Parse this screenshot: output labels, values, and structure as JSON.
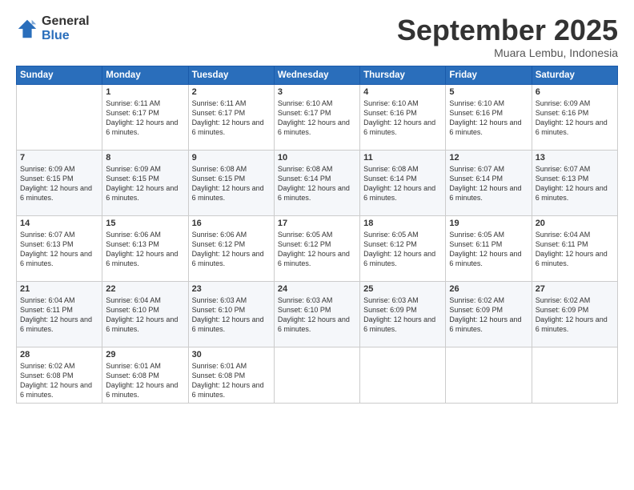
{
  "header": {
    "logo_general": "General",
    "logo_blue": "Blue",
    "month": "September 2025",
    "location": "Muara Lembu, Indonesia"
  },
  "weekdays": [
    "Sunday",
    "Monday",
    "Tuesday",
    "Wednesday",
    "Thursday",
    "Friday",
    "Saturday"
  ],
  "weeks": [
    [
      {
        "day": "",
        "sunrise": "",
        "sunset": "",
        "daylight": ""
      },
      {
        "day": "1",
        "sunrise": "Sunrise: 6:11 AM",
        "sunset": "Sunset: 6:17 PM",
        "daylight": "Daylight: 12 hours and 6 minutes."
      },
      {
        "day": "2",
        "sunrise": "Sunrise: 6:11 AM",
        "sunset": "Sunset: 6:17 PM",
        "daylight": "Daylight: 12 hours and 6 minutes."
      },
      {
        "day": "3",
        "sunrise": "Sunrise: 6:10 AM",
        "sunset": "Sunset: 6:17 PM",
        "daylight": "Daylight: 12 hours and 6 minutes."
      },
      {
        "day": "4",
        "sunrise": "Sunrise: 6:10 AM",
        "sunset": "Sunset: 6:16 PM",
        "daylight": "Daylight: 12 hours and 6 minutes."
      },
      {
        "day": "5",
        "sunrise": "Sunrise: 6:10 AM",
        "sunset": "Sunset: 6:16 PM",
        "daylight": "Daylight: 12 hours and 6 minutes."
      },
      {
        "day": "6",
        "sunrise": "Sunrise: 6:09 AM",
        "sunset": "Sunset: 6:16 PM",
        "daylight": "Daylight: 12 hours and 6 minutes."
      }
    ],
    [
      {
        "day": "7",
        "sunrise": "Sunrise: 6:09 AM",
        "sunset": "Sunset: 6:15 PM",
        "daylight": "Daylight: 12 hours and 6 minutes."
      },
      {
        "day": "8",
        "sunrise": "Sunrise: 6:09 AM",
        "sunset": "Sunset: 6:15 PM",
        "daylight": "Daylight: 12 hours and 6 minutes."
      },
      {
        "day": "9",
        "sunrise": "Sunrise: 6:08 AM",
        "sunset": "Sunset: 6:15 PM",
        "daylight": "Daylight: 12 hours and 6 minutes."
      },
      {
        "day": "10",
        "sunrise": "Sunrise: 6:08 AM",
        "sunset": "Sunset: 6:14 PM",
        "daylight": "Daylight: 12 hours and 6 minutes."
      },
      {
        "day": "11",
        "sunrise": "Sunrise: 6:08 AM",
        "sunset": "Sunset: 6:14 PM",
        "daylight": "Daylight: 12 hours and 6 minutes."
      },
      {
        "day": "12",
        "sunrise": "Sunrise: 6:07 AM",
        "sunset": "Sunset: 6:14 PM",
        "daylight": "Daylight: 12 hours and 6 minutes."
      },
      {
        "day": "13",
        "sunrise": "Sunrise: 6:07 AM",
        "sunset": "Sunset: 6:13 PM",
        "daylight": "Daylight: 12 hours and 6 minutes."
      }
    ],
    [
      {
        "day": "14",
        "sunrise": "Sunrise: 6:07 AM",
        "sunset": "Sunset: 6:13 PM",
        "daylight": "Daylight: 12 hours and 6 minutes."
      },
      {
        "day": "15",
        "sunrise": "Sunrise: 6:06 AM",
        "sunset": "Sunset: 6:13 PM",
        "daylight": "Daylight: 12 hours and 6 minutes."
      },
      {
        "day": "16",
        "sunrise": "Sunrise: 6:06 AM",
        "sunset": "Sunset: 6:12 PM",
        "daylight": "Daylight: 12 hours and 6 minutes."
      },
      {
        "day": "17",
        "sunrise": "Sunrise: 6:05 AM",
        "sunset": "Sunset: 6:12 PM",
        "daylight": "Daylight: 12 hours and 6 minutes."
      },
      {
        "day": "18",
        "sunrise": "Sunrise: 6:05 AM",
        "sunset": "Sunset: 6:12 PM",
        "daylight": "Daylight: 12 hours and 6 minutes."
      },
      {
        "day": "19",
        "sunrise": "Sunrise: 6:05 AM",
        "sunset": "Sunset: 6:11 PM",
        "daylight": "Daylight: 12 hours and 6 minutes."
      },
      {
        "day": "20",
        "sunrise": "Sunrise: 6:04 AM",
        "sunset": "Sunset: 6:11 PM",
        "daylight": "Daylight: 12 hours and 6 minutes."
      }
    ],
    [
      {
        "day": "21",
        "sunrise": "Sunrise: 6:04 AM",
        "sunset": "Sunset: 6:11 PM",
        "daylight": "Daylight: 12 hours and 6 minutes."
      },
      {
        "day": "22",
        "sunrise": "Sunrise: 6:04 AM",
        "sunset": "Sunset: 6:10 PM",
        "daylight": "Daylight: 12 hours and 6 minutes."
      },
      {
        "day": "23",
        "sunrise": "Sunrise: 6:03 AM",
        "sunset": "Sunset: 6:10 PM",
        "daylight": "Daylight: 12 hours and 6 minutes."
      },
      {
        "day": "24",
        "sunrise": "Sunrise: 6:03 AM",
        "sunset": "Sunset: 6:10 PM",
        "daylight": "Daylight: 12 hours and 6 minutes."
      },
      {
        "day": "25",
        "sunrise": "Sunrise: 6:03 AM",
        "sunset": "Sunset: 6:09 PM",
        "daylight": "Daylight: 12 hours and 6 minutes."
      },
      {
        "day": "26",
        "sunrise": "Sunrise: 6:02 AM",
        "sunset": "Sunset: 6:09 PM",
        "daylight": "Daylight: 12 hours and 6 minutes."
      },
      {
        "day": "27",
        "sunrise": "Sunrise: 6:02 AM",
        "sunset": "Sunset: 6:09 PM",
        "daylight": "Daylight: 12 hours and 6 minutes."
      }
    ],
    [
      {
        "day": "28",
        "sunrise": "Sunrise: 6:02 AM",
        "sunset": "Sunset: 6:08 PM",
        "daylight": "Daylight: 12 hours and 6 minutes."
      },
      {
        "day": "29",
        "sunrise": "Sunrise: 6:01 AM",
        "sunset": "Sunset: 6:08 PM",
        "daylight": "Daylight: 12 hours and 6 minutes."
      },
      {
        "day": "30",
        "sunrise": "Sunrise: 6:01 AM",
        "sunset": "Sunset: 6:08 PM",
        "daylight": "Daylight: 12 hours and 6 minutes."
      },
      {
        "day": "",
        "sunrise": "",
        "sunset": "",
        "daylight": ""
      },
      {
        "day": "",
        "sunrise": "",
        "sunset": "",
        "daylight": ""
      },
      {
        "day": "",
        "sunrise": "",
        "sunset": "",
        "daylight": ""
      },
      {
        "day": "",
        "sunrise": "",
        "sunset": "",
        "daylight": ""
      }
    ]
  ]
}
